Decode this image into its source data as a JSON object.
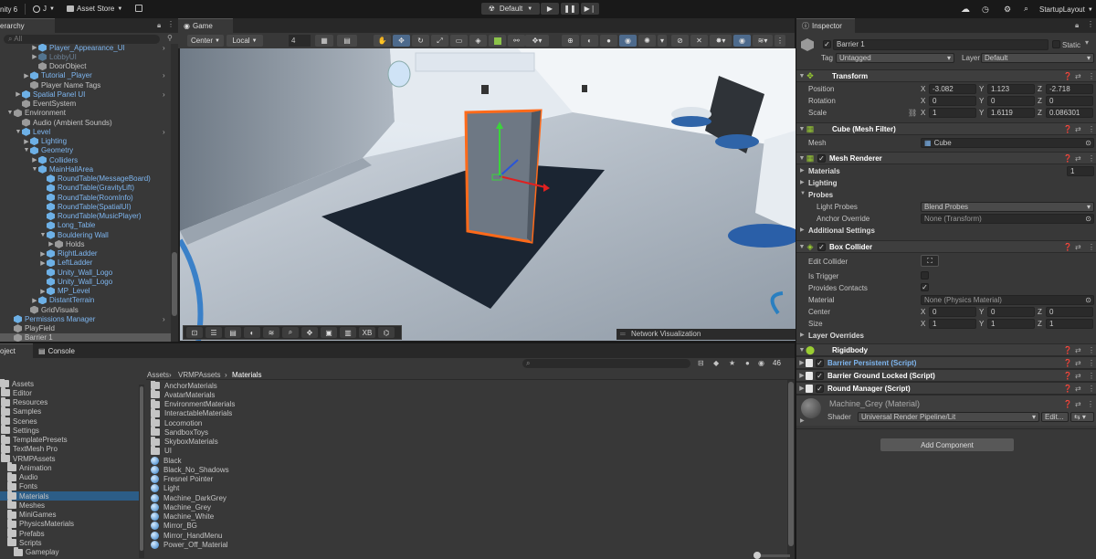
{
  "topbar": {
    "app": "nity 6",
    "account": "J",
    "asset_store": "Asset Store",
    "platform": "Default",
    "layout": "StartupLayout"
  },
  "hierarchy": {
    "tab": "erarchy",
    "search_placeholder": "All",
    "items": [
      {
        "label": "Player_Appearance_UI",
        "indent": 4,
        "kind": "prefab",
        "color": "blue",
        "arrow": true,
        "chev": true
      },
      {
        "label": "LobbyUI",
        "indent": 4,
        "kind": "prefab",
        "color": "dim",
        "arrow": true
      },
      {
        "label": "DoorObject",
        "indent": 4,
        "kind": "cubeg",
        "color": "norm"
      },
      {
        "label": "Tutorial _Player",
        "indent": 3,
        "kind": "prefab",
        "color": "blue",
        "arrow": true,
        "chev": true
      },
      {
        "label": "Player Name Tags",
        "indent": 3,
        "kind": "cubeg",
        "color": "norm"
      },
      {
        "label": "Spatial Panel UI",
        "indent": 2,
        "kind": "prefab",
        "color": "blue",
        "arrow": true,
        "chev": true
      },
      {
        "label": "EventSystem",
        "indent": 2,
        "kind": "cubeg",
        "color": "norm"
      },
      {
        "label": "Environment",
        "indent": 1,
        "kind": "cubeg",
        "color": "norm",
        "arrow": true,
        "open": true
      },
      {
        "label": "Audio (Ambient Sounds)",
        "indent": 2,
        "kind": "cubeg",
        "color": "norm"
      },
      {
        "label": "Level",
        "indent": 2,
        "kind": "prefab",
        "color": "blue",
        "arrow": true,
        "open": true,
        "chev": true
      },
      {
        "label": "Lighting",
        "indent": 3,
        "kind": "prefab",
        "color": "blue",
        "arrow": true
      },
      {
        "label": "Geometry",
        "indent": 3,
        "kind": "prefab",
        "color": "blue",
        "arrow": true,
        "open": true
      },
      {
        "label": "Colliders",
        "indent": 4,
        "kind": "prefab",
        "color": "blue",
        "arrow": true
      },
      {
        "label": "MainHallArea",
        "indent": 4,
        "kind": "prefab",
        "color": "blue",
        "arrow": true,
        "open": true
      },
      {
        "label": "RoundTable(MessageBoard)",
        "indent": 5,
        "kind": "prefab",
        "color": "blue"
      },
      {
        "label": "RoundTable(GravityLift)",
        "indent": 5,
        "kind": "prefab",
        "color": "blue"
      },
      {
        "label": "RoundTable(RoomInfo)",
        "indent": 5,
        "kind": "prefab",
        "color": "blue"
      },
      {
        "label": "RoundTable(SpatialUI)",
        "indent": 5,
        "kind": "prefab",
        "color": "blue"
      },
      {
        "label": "RoundTable(MusicPlayer)",
        "indent": 5,
        "kind": "prefab",
        "color": "blue"
      },
      {
        "label": "Long_Table",
        "indent": 5,
        "kind": "prefab",
        "color": "blue"
      },
      {
        "label": "Bouldering Wall",
        "indent": 5,
        "kind": "prefab",
        "color": "blue",
        "arrow": true,
        "open": true
      },
      {
        "label": "Holds",
        "indent": 6,
        "kind": "cubeg",
        "color": "norm",
        "arrow": true
      },
      {
        "label": "RightLadder",
        "indent": 5,
        "kind": "prefab",
        "color": "blue",
        "arrow": true
      },
      {
        "label": "LeftLadder",
        "indent": 5,
        "kind": "prefab",
        "color": "blue",
        "arrow": true
      },
      {
        "label": "Unity_Wall_Logo",
        "indent": 5,
        "kind": "prefab",
        "color": "blue"
      },
      {
        "label": "Unity_Wall_Logo",
        "indent": 5,
        "kind": "prefab",
        "color": "blue"
      },
      {
        "label": "MP_Level",
        "indent": 5,
        "kind": "prefab",
        "color": "blue",
        "arrow": true
      },
      {
        "label": "DistantTerrain",
        "indent": 4,
        "kind": "prefab",
        "color": "blue",
        "arrow": true
      },
      {
        "label": "GridVisuals",
        "indent": 3,
        "kind": "cubeg",
        "color": "norm"
      },
      {
        "label": "Permissions Manager",
        "indent": 1,
        "kind": "prefab",
        "color": "blue",
        "chev": true
      },
      {
        "label": "PlayField",
        "indent": 1,
        "kind": "cubeg",
        "color": "norm"
      },
      {
        "label": "Barrier 1",
        "indent": 1,
        "kind": "cubeg",
        "color": "norm",
        "selected": true
      }
    ]
  },
  "scene": {
    "tab": "Game",
    "pivot": "Center",
    "space": "Local",
    "snap": "4",
    "network_label": "Network Visualization",
    "overlay_xb": "XB"
  },
  "inspector": {
    "tab": "Inspector",
    "object_name": "Barrier 1",
    "static": "Static",
    "tag_label": "Tag",
    "tag": "Untagged",
    "layer_label": "Layer",
    "layer": "Default",
    "transform": {
      "title": "Transform",
      "position_label": "Position",
      "position": [
        "-3.082",
        "1.123",
        "-2.718"
      ],
      "rotation_label": "Rotation",
      "rotation": [
        "0",
        "0",
        "0"
      ],
      "scale_label": "Scale",
      "scale": [
        "1",
        "1.6119",
        "0.086301"
      ]
    },
    "axis": [
      "X",
      "Y",
      "Z"
    ],
    "mesh_filter": {
      "title": "Cube (Mesh Filter)",
      "mesh_label": "Mesh",
      "mesh": "Cube"
    },
    "mesh_renderer": {
      "title": "Mesh Renderer",
      "materials": "Materials",
      "materials_count": "1",
      "lighting": "Lighting",
      "probes": "Probes",
      "light_probes_label": "Light Probes",
      "light_probes": "Blend Probes",
      "anchor_label": "Anchor Override",
      "anchor": "None (Transform)",
      "additional": "Additional Settings"
    },
    "box_collider": {
      "title": "Box Collider",
      "edit_label": "Edit Collider",
      "trigger_label": "Is Trigger",
      "contacts_label": "Provides Contacts",
      "material_label": "Material",
      "material": "None (Physics Material)",
      "center_label": "Center",
      "center": [
        "0",
        "0",
        "0"
      ],
      "size_label": "Size",
      "size": [
        "1",
        "1",
        "1"
      ],
      "layer_overrides": "Layer Overrides"
    },
    "rigidbody": "Rigidbody",
    "scripts": [
      "Barrier Persistent (Script)",
      "Barrier Ground Locked (Script)",
      "Round Manager (Script)"
    ],
    "material": {
      "name": "Machine_Grey (Material)",
      "shader_label": "Shader",
      "shader": "Universal Render Pipeline/Lit",
      "edit": "Edit..."
    },
    "add_component": "Add Component"
  },
  "project": {
    "tabs": [
      "oject",
      "Console"
    ],
    "count": "46",
    "breadcrumb": [
      "Assets",
      "VRMPAssets",
      "Materials"
    ],
    "tree": [
      {
        "label": "Assets",
        "indent": 0
      },
      {
        "label": "Editor",
        "indent": 1
      },
      {
        "label": "Resources",
        "indent": 1
      },
      {
        "label": "Samples",
        "indent": 1
      },
      {
        "label": "Scenes",
        "indent": 1
      },
      {
        "label": "Settings",
        "indent": 1
      },
      {
        "label": "TemplatePresets",
        "indent": 1
      },
      {
        "label": "TextMesh Pro",
        "indent": 1
      },
      {
        "label": "VRMPAssets",
        "indent": 1
      },
      {
        "label": "Animation",
        "indent": 2
      },
      {
        "label": "Audio",
        "indent": 2
      },
      {
        "label": "Fonts",
        "indent": 2
      },
      {
        "label": "Materials",
        "indent": 2,
        "selected": true
      },
      {
        "label": "Meshes",
        "indent": 2
      },
      {
        "label": "MiniGames",
        "indent": 2
      },
      {
        "label": "PhysicsMaterials",
        "indent": 2
      },
      {
        "label": "Prefabs",
        "indent": 2
      },
      {
        "label": "Scripts",
        "indent": 2
      },
      {
        "label": "Gameplay",
        "indent": 3
      }
    ],
    "files": [
      {
        "label": "AnchorMaterials",
        "kind": "folder"
      },
      {
        "label": "AvatarMaterials",
        "kind": "folder"
      },
      {
        "label": "EnvironmentMaterials",
        "kind": "folder"
      },
      {
        "label": "InteractableMaterials",
        "kind": "folder"
      },
      {
        "label": "Locomotion",
        "kind": "folder"
      },
      {
        "label": "SandboxToys",
        "kind": "folder"
      },
      {
        "label": "SkyboxMaterials",
        "kind": "folder"
      },
      {
        "label": "UI",
        "kind": "folder"
      },
      {
        "label": "Black",
        "kind": "mat"
      },
      {
        "label": "Black_No_Shadows",
        "kind": "mat"
      },
      {
        "label": "Fresnel Pointer",
        "kind": "mat"
      },
      {
        "label": "Light",
        "kind": "mat"
      },
      {
        "label": "Machine_DarkGrey",
        "kind": "mat"
      },
      {
        "label": "Machine_Grey",
        "kind": "mat"
      },
      {
        "label": "Machine_White",
        "kind": "mat"
      },
      {
        "label": "Mirror_BG",
        "kind": "mat"
      },
      {
        "label": "Mirror_HandMenu",
        "kind": "mat"
      },
      {
        "label": "Power_Off_Material",
        "kind": "mat"
      }
    ]
  }
}
